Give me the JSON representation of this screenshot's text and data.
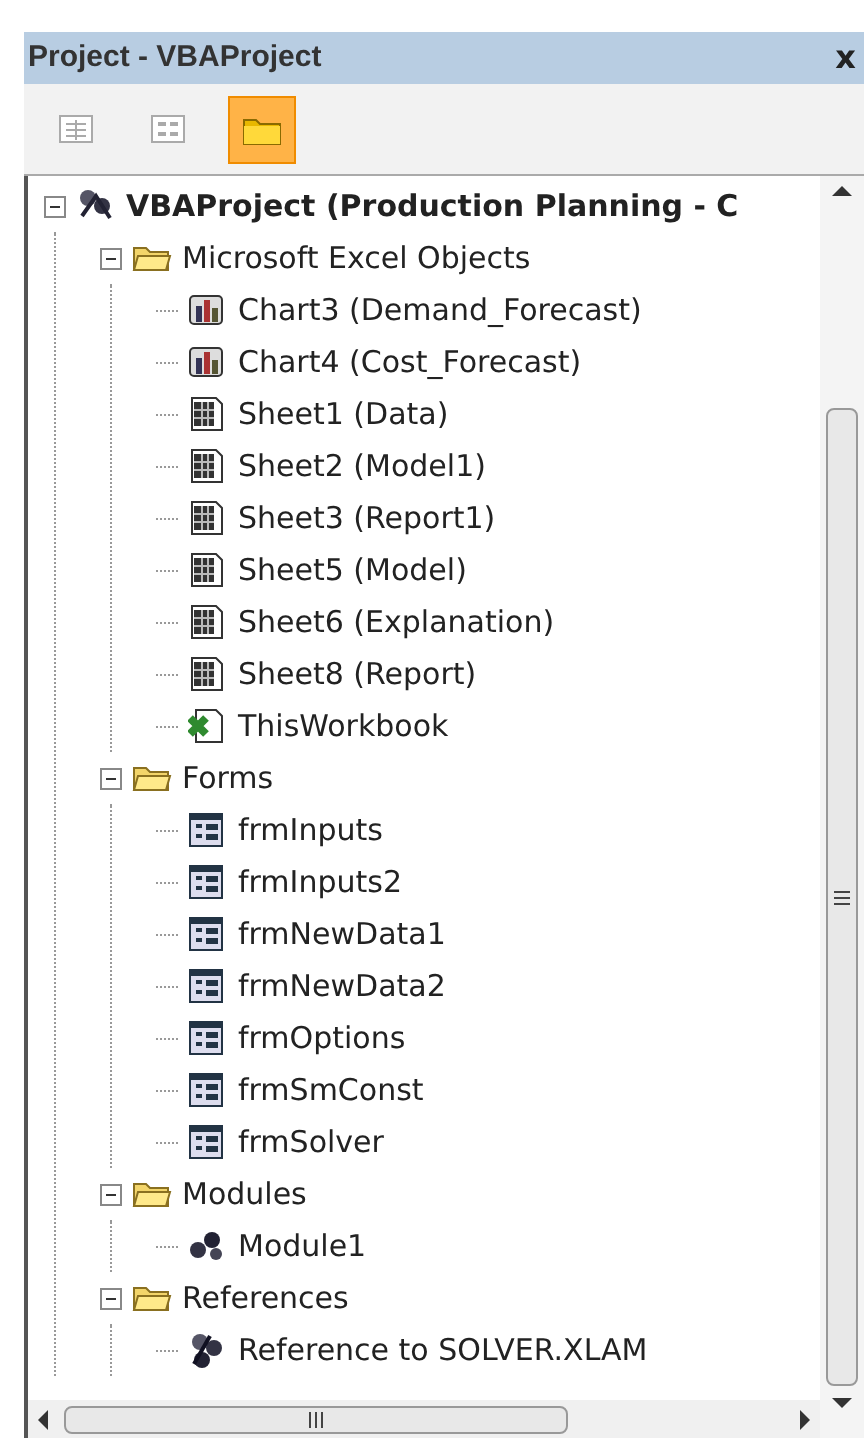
{
  "window": {
    "title": "Project - VBAProject",
    "close": "x"
  },
  "toolbar": [
    {
      "disabled": true,
      "selected": false
    },
    {
      "disabled": true,
      "selected": false
    },
    {
      "disabled": false,
      "selected": true
    }
  ],
  "tree": [
    {
      "kind": "project",
      "label": "VBAProject (Production Planning - C",
      "expanded": true,
      "children": [
        {
          "kind": "folder",
          "label": "Microsoft Excel Objects",
          "expanded": true,
          "children": [
            {
              "kind": "chart",
              "label": "Chart3 (Demand_Forecast)"
            },
            {
              "kind": "chart",
              "label": "Chart4 (Cost_Forecast)"
            },
            {
              "kind": "sheet",
              "label": "Sheet1 (Data)"
            },
            {
              "kind": "sheet",
              "label": "Sheet2 (Model1)"
            },
            {
              "kind": "sheet",
              "label": "Sheet3 (Report1)"
            },
            {
              "kind": "sheet",
              "label": "Sheet5 (Model)"
            },
            {
              "kind": "sheet",
              "label": "Sheet6 (Explanation)"
            },
            {
              "kind": "sheet",
              "label": "Sheet8 (Report)"
            },
            {
              "kind": "workbook",
              "label": "ThisWorkbook"
            }
          ]
        },
        {
          "kind": "folder",
          "label": "Forms",
          "expanded": true,
          "children": [
            {
              "kind": "form",
              "label": "frmInputs"
            },
            {
              "kind": "form",
              "label": "frmInputs2"
            },
            {
              "kind": "form",
              "label": "frmNewData1"
            },
            {
              "kind": "form",
              "label": "frmNewData2"
            },
            {
              "kind": "form",
              "label": "frmOptions"
            },
            {
              "kind": "form",
              "label": "frmSmConst"
            },
            {
              "kind": "form",
              "label": "frmSolver"
            }
          ]
        },
        {
          "kind": "folder",
          "label": "Modules",
          "expanded": true,
          "children": [
            {
              "kind": "module",
              "label": "Module1"
            }
          ]
        },
        {
          "kind": "folder",
          "label": "References",
          "expanded": true,
          "children": [
            {
              "kind": "reference",
              "label": "Reference to SOLVER.XLAM"
            }
          ]
        }
      ]
    }
  ]
}
